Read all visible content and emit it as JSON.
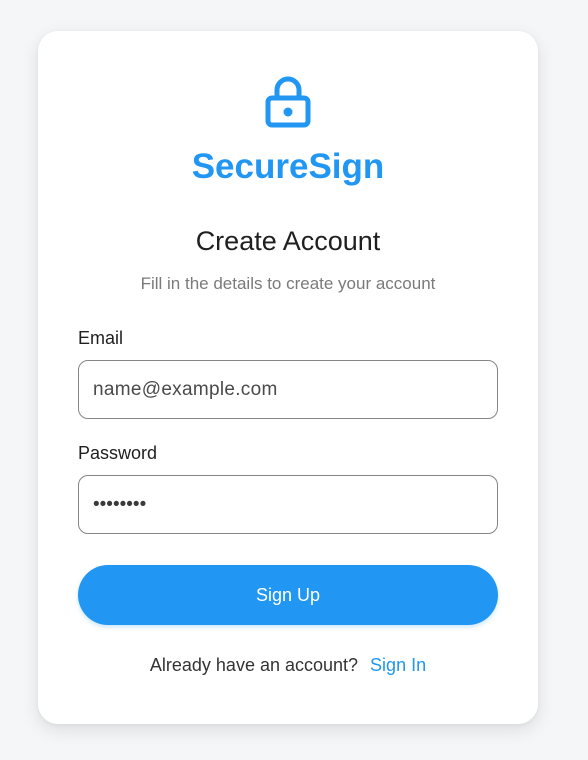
{
  "theme": {
    "accent": "#2196F3"
  },
  "brand": {
    "icon": "lock-icon",
    "name": "SecureSign"
  },
  "form": {
    "title": "Create Account",
    "subtitle": "Fill in the details to create your account",
    "email": {
      "label": "Email",
      "placeholder": "name@example.com",
      "value": ""
    },
    "password": {
      "label": "Password",
      "value": "password"
    },
    "submit_label": "Sign Up"
  },
  "footer": {
    "prompt": "Already have an account?",
    "link_label": "Sign In"
  }
}
